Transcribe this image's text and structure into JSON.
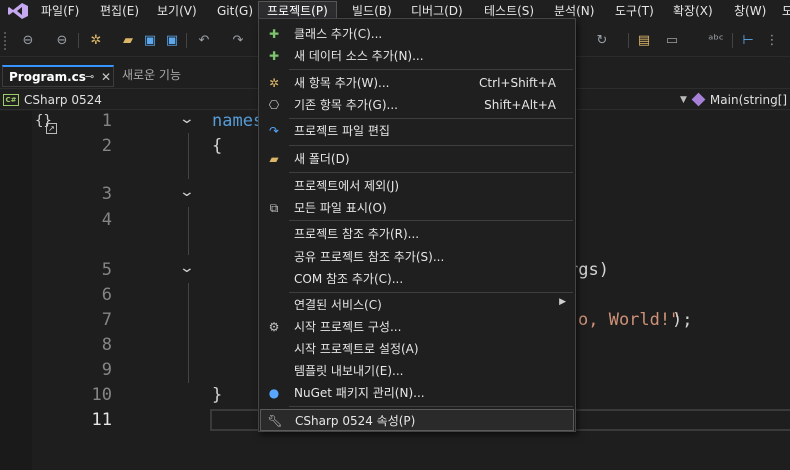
{
  "menubar": {
    "items": [
      "파일(F)",
      "편집(E)",
      "보기(V)",
      "Git(G)",
      "프로젝트(P)",
      "빌드(B)",
      "디버그(D)",
      "테스트(S)",
      "분석(N)",
      "도구(T)",
      "확장(X)",
      "창(W)",
      "도"
    ],
    "active_index": 4
  },
  "tabs": {
    "active": "Program.cs",
    "inactive": "새로운 기능"
  },
  "navbar": {
    "project": "CSharp 0524",
    "member": "Main(string[] a"
  },
  "editor": {
    "line_numbers": [
      "1",
      "2",
      "3",
      "4",
      "5",
      "6",
      "7",
      "8",
      "9",
      "10",
      "11"
    ],
    "current_line": "11",
    "fragments": {
      "namespace": "names",
      "open_brace": "{",
      "close_brace": "}",
      "args": "rgs)",
      "string": "o, World!\"",
      "tail": ");"
    }
  },
  "dropdown": {
    "items": [
      {
        "label": "클래스 추가(C)...",
        "icon": "add-class-icon"
      },
      {
        "label": "새 데이터 소스 추가(N)...",
        "icon": "add-datasource-icon"
      },
      {
        "label": "새 항목 추가(W)...",
        "shortcut": "Ctrl+Shift+A",
        "icon": "new-item-icon"
      },
      {
        "label": "기존 항목 추가(G)...",
        "shortcut": "Shift+Alt+A",
        "icon": "existing-item-icon"
      },
      {
        "label": "프로젝트 파일 편집",
        "icon": "edit-project-icon"
      },
      {
        "label": "새 폴더(D)",
        "icon": "new-folder-icon"
      },
      {
        "label": "프로젝트에서 제외(J)",
        "icon": ""
      },
      {
        "label": "모든 파일 표시(O)",
        "icon": "show-all-files-icon"
      },
      {
        "label": "프로젝트 참조 추가(R)...",
        "icon": ""
      },
      {
        "label": "공유 프로젝트 참조 추가(S)...",
        "icon": ""
      },
      {
        "label": "COM 참조 추가(C)...",
        "icon": ""
      },
      {
        "label": "연결된 서비스(C)",
        "icon": "",
        "submenu": true
      },
      {
        "label": "시작 프로젝트 구성...",
        "icon": "gear-icon"
      },
      {
        "label": "시작 프로젝트로 설정(A)",
        "icon": ""
      },
      {
        "label": "템플릿 내보내기(E)...",
        "icon": ""
      },
      {
        "label": "NuGet 패키지 관리(N)...",
        "icon": "nuget-icon"
      },
      {
        "label": "CSharp 0524 속성(P)",
        "icon": "wrench-icon",
        "highlighted": true
      }
    ]
  }
}
